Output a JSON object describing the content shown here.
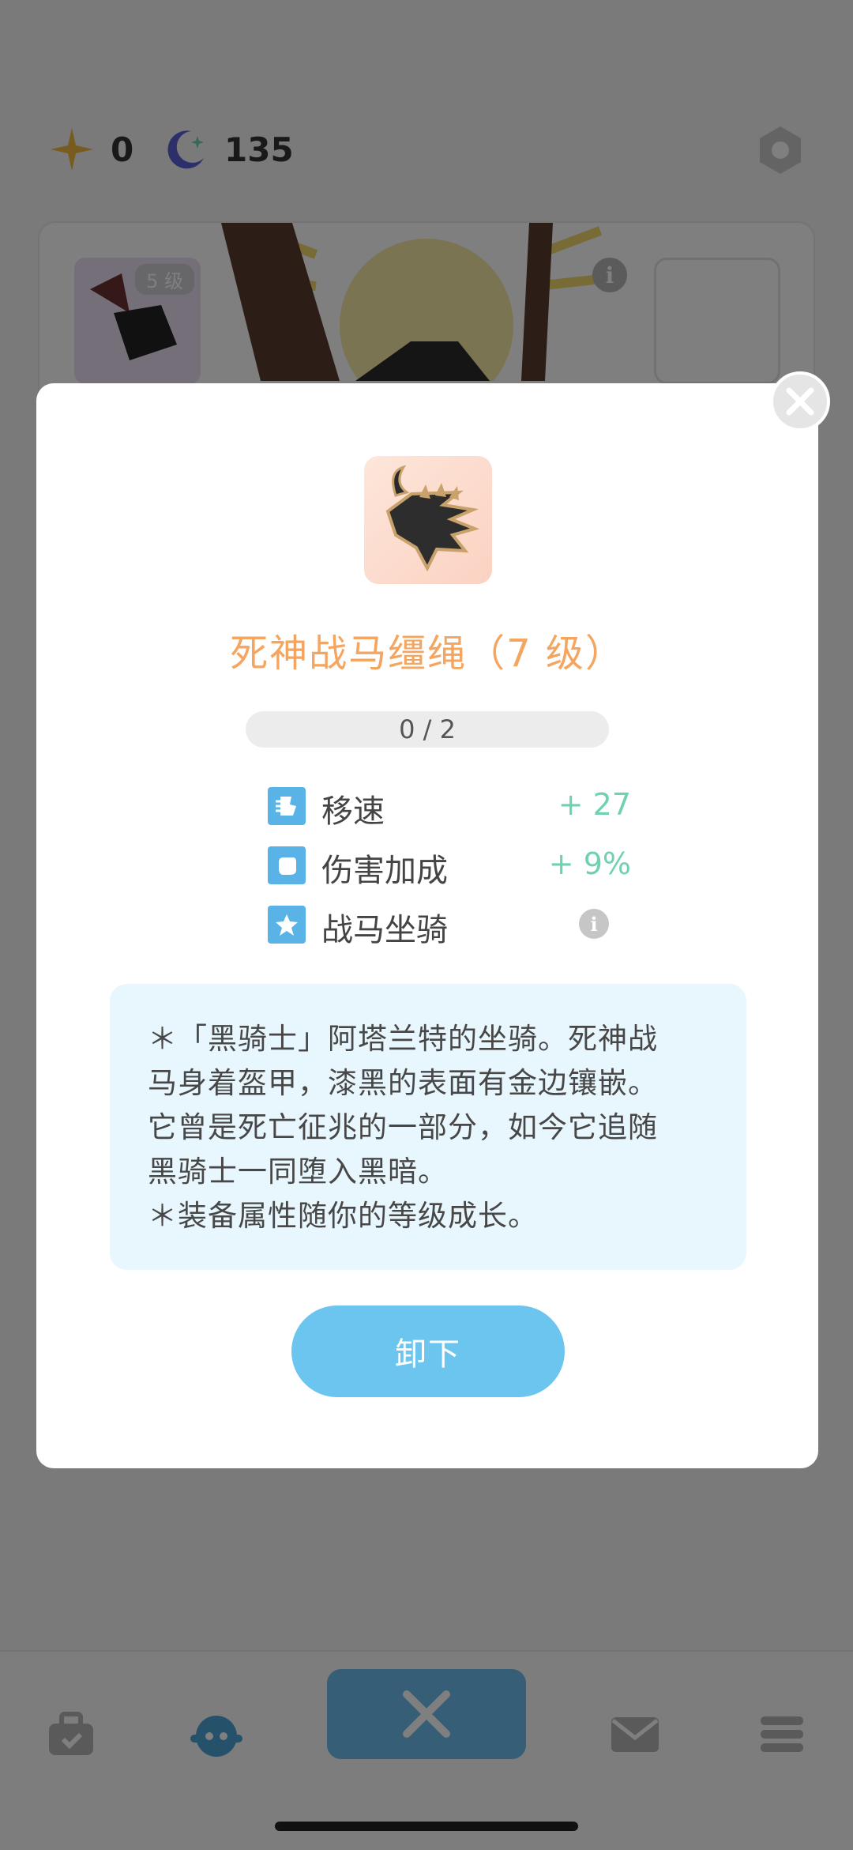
{
  "header": {
    "currencies": [
      {
        "icon": "gold-star-icon",
        "value": "0"
      },
      {
        "icon": "moon-icon",
        "value": "135"
      }
    ],
    "settings_icon": "hexagon-settings-icon"
  },
  "equip_card": {
    "level_badge": "5 级"
  },
  "modal": {
    "item_icon": "horse-helmet-icon",
    "title": "死神战马缰绳（7 级）",
    "progress": {
      "current": 0,
      "max": 2,
      "text": "0 / 2"
    },
    "stats": [
      {
        "icon": "speed-icon",
        "name": "移速",
        "value": "+ 27"
      },
      {
        "icon": "fist-icon",
        "name": "伤害加成",
        "value": "+ 9%"
      },
      {
        "icon": "star-icon",
        "name": "战马坐骑",
        "value": ""
      }
    ],
    "description": [
      "＊「黑骑士」阿塔兰特的坐骑。死神战",
      "马身着盔甲，漆黑的表面有金边镶嵌。",
      "它曾是死亡征兆的一部分，如今它追随",
      "黑骑士一同堕入黑暗。",
      "＊装备属性随你的等级成长。"
    ],
    "unequip_button": "卸下"
  },
  "bottom_nav": {
    "items": [
      "bag-icon",
      "character-icon",
      "battle-icon",
      "mail-icon",
      "menu-icon"
    ],
    "active": "battle-icon"
  },
  "colors": {
    "accent_blue": "#6cc5ee",
    "title_orange": "#f4a55f",
    "stat_green": "#6fd1b2",
    "desc_bg": "#e8f6fe"
  }
}
